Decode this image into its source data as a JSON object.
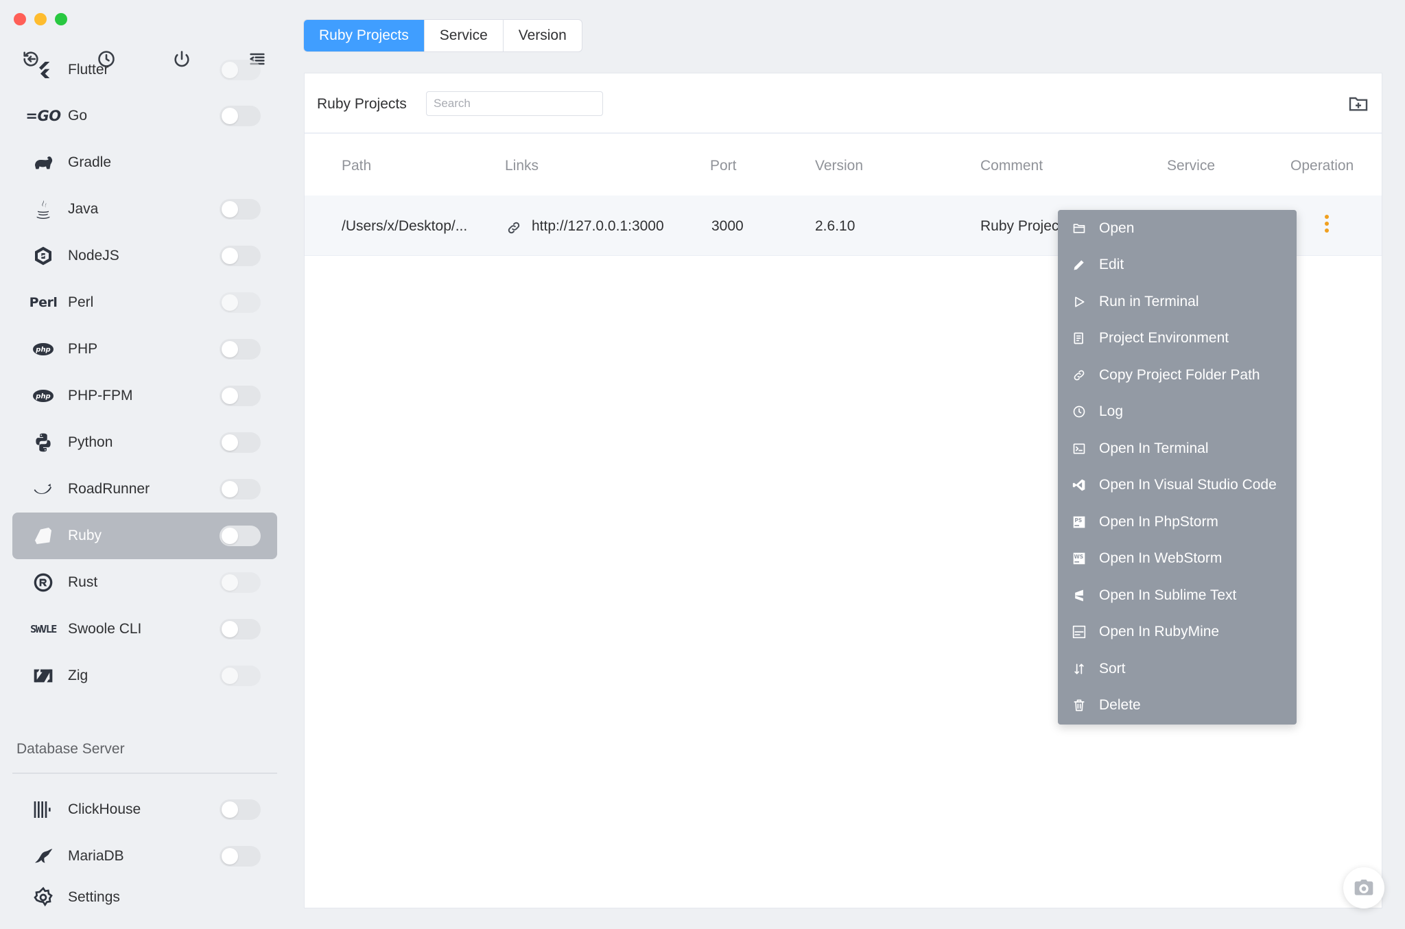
{
  "window": {
    "controls": [
      "close",
      "minimize",
      "zoom"
    ]
  },
  "sidebar": {
    "top_tools": [
      {
        "name": "back-icon"
      },
      {
        "name": "history-icon"
      },
      {
        "name": "power-icon"
      },
      {
        "name": "menu-collapse-icon"
      }
    ],
    "items": [
      {
        "label": "Flutter",
        "icon": "flutter-icon",
        "toggle": false
      },
      {
        "label": "Go",
        "icon": "go-icon",
        "icon_text": "=GO",
        "toggle": false
      },
      {
        "label": "Gradle",
        "icon": "gradle-icon"
      },
      {
        "label": "Java",
        "icon": "java-icon",
        "toggle": false
      },
      {
        "label": "NodeJS",
        "icon": "nodejs-icon",
        "toggle": false
      },
      {
        "label": "Perl",
        "icon": "perl-icon",
        "icon_text": "Perl",
        "toggle": false
      },
      {
        "label": "PHP",
        "icon": "php-icon",
        "toggle": false
      },
      {
        "label": "PHP-FPM",
        "icon": "php-fpm-icon",
        "toggle": false
      },
      {
        "label": "Python",
        "icon": "python-icon",
        "toggle": false
      },
      {
        "label": "RoadRunner",
        "icon": "roadrunner-icon",
        "toggle": false
      },
      {
        "label": "Ruby",
        "icon": "ruby-icon",
        "toggle": false,
        "active": true
      },
      {
        "label": "Rust",
        "icon": "rust-icon",
        "toggle": false
      },
      {
        "label": "Swoole CLI",
        "icon": "swoole-icon",
        "icon_text": "SWVLE",
        "toggle": false
      },
      {
        "label": "Zig",
        "icon": "zig-icon",
        "toggle": false
      }
    ],
    "section_title": "Database Server",
    "db_items": [
      {
        "label": "ClickHouse",
        "icon": "clickhouse-icon",
        "toggle": false
      },
      {
        "label": "MariaDB",
        "icon": "mariadb-icon",
        "toggle": false
      }
    ],
    "settings_label": "Settings"
  },
  "tabs": [
    {
      "label": "Ruby Projects",
      "active": true
    },
    {
      "label": "Service",
      "active": false
    },
    {
      "label": "Version",
      "active": false
    }
  ],
  "panel": {
    "title": "Ruby Projects",
    "search_placeholder": "Search",
    "add_folder_icon": "folder-add-icon"
  },
  "table": {
    "columns": [
      "Path",
      "Links",
      "Port",
      "Version",
      "Comment",
      "Service",
      "Operation"
    ],
    "rows": [
      {
        "path": "/Users/x/Desktop/...",
        "link": "http://127.0.0.1:3000",
        "port": "3000",
        "version": "2.6.10",
        "comment": "Ruby Projec"
      }
    ]
  },
  "context_menu": {
    "items": [
      {
        "label": "Open",
        "icon": "folder-icon"
      },
      {
        "label": "Edit",
        "icon": "pencil-icon"
      },
      {
        "label": "Run in Terminal",
        "icon": "play-icon"
      },
      {
        "label": "Project Environment",
        "icon": "env-icon"
      },
      {
        "label": "Copy Project Folder Path",
        "icon": "copy-link-icon"
      },
      {
        "label": "Log",
        "icon": "clock-icon"
      },
      {
        "label": "Open In Terminal",
        "icon": "terminal-icon"
      },
      {
        "label": "Open In Visual Studio Code",
        "icon": "vscode-icon"
      },
      {
        "label": "Open In PhpStorm",
        "icon": "phpstorm-icon",
        "icon_text": "PS"
      },
      {
        "label": "Open In WebStorm",
        "icon": "webstorm-icon",
        "icon_text": "WS"
      },
      {
        "label": "Open In Sublime Text",
        "icon": "sublime-icon"
      },
      {
        "label": "Open In RubyMine",
        "icon": "rubymine-icon"
      },
      {
        "label": "Sort",
        "icon": "sort-icon"
      },
      {
        "label": "Delete",
        "icon": "trash-icon"
      }
    ]
  },
  "colors": {
    "accent": "#409eff",
    "menu_bg": "#939aa4",
    "active_sidebar": "#b6bac1",
    "operation_dots": "#f0a020"
  },
  "floating": {
    "camera_icon": "camera-icon"
  }
}
